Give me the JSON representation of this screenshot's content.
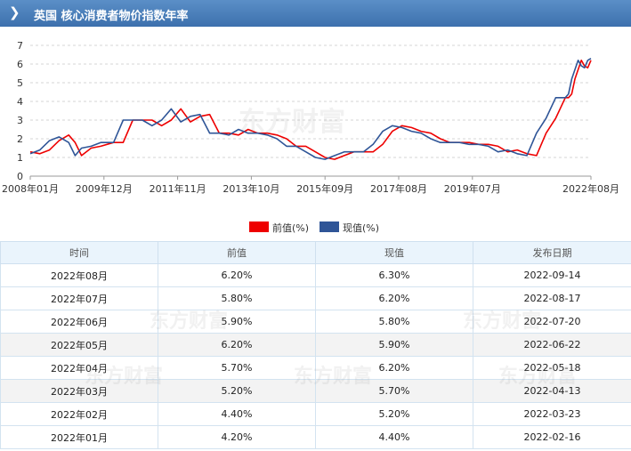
{
  "header": {
    "title": "英国 核心消费者物价指数年率"
  },
  "watermark": "东方财富",
  "legend": [
    {
      "label": "前值(%)",
      "color": "#ee0000"
    },
    {
      "label": "现值(%)",
      "color": "#2f5597"
    }
  ],
  "chart_data": {
    "type": "line",
    "ylim": [
      0,
      7
    ],
    "yticks": [
      0,
      1,
      2,
      3,
      4,
      5,
      6,
      7
    ],
    "xtick_labels": [
      "2008年01月",
      "2009年12月",
      "2011年11月",
      "2013年10月",
      "2015年09月",
      "2017年08月",
      "2019年07月",
      "2022年08月"
    ],
    "grid": "horizontal dashed",
    "legend_position": "bottom-center",
    "series": [
      {
        "name": "前值(%)",
        "color": "#ee0000",
        "points": [
          [
            "2008-01",
            1.3
          ],
          [
            "2008-04",
            1.2
          ],
          [
            "2008-07",
            1.4
          ],
          [
            "2008-10",
            1.9
          ],
          [
            "2009-01",
            2.2
          ],
          [
            "2009-03",
            1.8
          ],
          [
            "2009-05",
            1.1
          ],
          [
            "2009-08",
            1.5
          ],
          [
            "2009-11",
            1.6
          ],
          [
            "2010-03",
            1.8
          ],
          [
            "2010-06",
            1.8
          ],
          [
            "2010-09",
            3.0
          ],
          [
            "2010-12",
            3.0
          ],
          [
            "2011-03",
            3.0
          ],
          [
            "2011-06",
            2.7
          ],
          [
            "2011-09",
            3.0
          ],
          [
            "2011-12",
            3.6
          ],
          [
            "2012-03",
            2.9
          ],
          [
            "2012-06",
            3.2
          ],
          [
            "2012-09",
            3.3
          ],
          [
            "2012-12",
            2.3
          ],
          [
            "2013-03",
            2.3
          ],
          [
            "2013-06",
            2.2
          ],
          [
            "2013-09",
            2.5
          ],
          [
            "2013-12",
            2.3
          ],
          [
            "2014-03",
            2.3
          ],
          [
            "2014-06",
            2.2
          ],
          [
            "2014-09",
            2.0
          ],
          [
            "2014-12",
            1.6
          ],
          [
            "2015-03",
            1.6
          ],
          [
            "2015-06",
            1.3
          ],
          [
            "2015-09",
            1.0
          ],
          [
            "2015-12",
            0.9
          ],
          [
            "2016-03",
            1.1
          ],
          [
            "2016-06",
            1.3
          ],
          [
            "2016-09",
            1.3
          ],
          [
            "2016-12",
            1.3
          ],
          [
            "2017-03",
            1.7
          ],
          [
            "2017-06",
            2.4
          ],
          [
            "2017-09",
            2.7
          ],
          [
            "2017-12",
            2.6
          ],
          [
            "2018-03",
            2.4
          ],
          [
            "2018-06",
            2.3
          ],
          [
            "2018-09",
            2.0
          ],
          [
            "2018-12",
            1.8
          ],
          [
            "2019-03",
            1.8
          ],
          [
            "2019-06",
            1.8
          ],
          [
            "2019-09",
            1.7
          ],
          [
            "2019-12",
            1.7
          ],
          [
            "2020-03",
            1.6
          ],
          [
            "2020-06",
            1.3
          ],
          [
            "2020-09",
            1.4
          ],
          [
            "2020-12",
            1.2
          ],
          [
            "2021-03",
            1.1
          ],
          [
            "2021-06",
            2.3
          ],
          [
            "2021-09",
            3.1
          ],
          [
            "2021-12",
            4.2
          ],
          [
            "2022-01",
            4.2
          ],
          [
            "2022-02",
            4.4
          ],
          [
            "2022-03",
            5.2
          ],
          [
            "2022-04",
            5.7
          ],
          [
            "2022-05",
            6.2
          ],
          [
            "2022-06",
            5.9
          ],
          [
            "2022-07",
            5.8
          ],
          [
            "2022-08",
            6.2
          ]
        ]
      },
      {
        "name": "现值(%)",
        "color": "#2f5597",
        "points": [
          [
            "2008-01",
            1.2
          ],
          [
            "2008-04",
            1.4
          ],
          [
            "2008-07",
            1.9
          ],
          [
            "2008-10",
            2.1
          ],
          [
            "2009-01",
            1.8
          ],
          [
            "2009-03",
            1.1
          ],
          [
            "2009-05",
            1.5
          ],
          [
            "2009-08",
            1.6
          ],
          [
            "2009-11",
            1.8
          ],
          [
            "2010-03",
            1.8
          ],
          [
            "2010-06",
            3.0
          ],
          [
            "2010-09",
            3.0
          ],
          [
            "2010-12",
            3.0
          ],
          [
            "2011-03",
            2.7
          ],
          [
            "2011-06",
            3.0
          ],
          [
            "2011-09",
            3.6
          ],
          [
            "2011-12",
            2.9
          ],
          [
            "2012-03",
            3.2
          ],
          [
            "2012-06",
            3.3
          ],
          [
            "2012-09",
            2.3
          ],
          [
            "2012-12",
            2.3
          ],
          [
            "2013-03",
            2.2
          ],
          [
            "2013-06",
            2.5
          ],
          [
            "2013-09",
            2.3
          ],
          [
            "2013-12",
            2.3
          ],
          [
            "2014-03",
            2.2
          ],
          [
            "2014-06",
            2.0
          ],
          [
            "2014-09",
            1.6
          ],
          [
            "2014-12",
            1.6
          ],
          [
            "2015-03",
            1.3
          ],
          [
            "2015-06",
            1.0
          ],
          [
            "2015-09",
            0.9
          ],
          [
            "2015-12",
            1.1
          ],
          [
            "2016-03",
            1.3
          ],
          [
            "2016-06",
            1.3
          ],
          [
            "2016-09",
            1.3
          ],
          [
            "2016-12",
            1.7
          ],
          [
            "2017-03",
            2.4
          ],
          [
            "2017-06",
            2.7
          ],
          [
            "2017-09",
            2.6
          ],
          [
            "2017-12",
            2.4
          ],
          [
            "2018-03",
            2.3
          ],
          [
            "2018-06",
            2.0
          ],
          [
            "2018-09",
            1.8
          ],
          [
            "2018-12",
            1.8
          ],
          [
            "2019-03",
            1.8
          ],
          [
            "2019-06",
            1.7
          ],
          [
            "2019-09",
            1.7
          ],
          [
            "2019-12",
            1.6
          ],
          [
            "2020-03",
            1.3
          ],
          [
            "2020-06",
            1.4
          ],
          [
            "2020-09",
            1.2
          ],
          [
            "2020-12",
            1.1
          ],
          [
            "2021-03",
            2.3
          ],
          [
            "2021-06",
            3.1
          ],
          [
            "2021-09",
            4.2
          ],
          [
            "2021-12",
            4.2
          ],
          [
            "2022-01",
            4.4
          ],
          [
            "2022-02",
            5.2
          ],
          [
            "2022-03",
            5.7
          ],
          [
            "2022-04",
            6.2
          ],
          [
            "2022-05",
            5.9
          ],
          [
            "2022-06",
            5.8
          ],
          [
            "2022-07",
            6.2
          ],
          [
            "2022-08",
            6.3
          ]
        ]
      }
    ]
  },
  "table": {
    "headers": [
      "时间",
      "前值",
      "现值",
      "发布日期"
    ],
    "rows": [
      [
        "2022年08月",
        "6.20%",
        "6.30%",
        "2022-09-14"
      ],
      [
        "2022年07月",
        "5.80%",
        "6.20%",
        "2022-08-17"
      ],
      [
        "2022年06月",
        "5.90%",
        "5.80%",
        "2022-07-20"
      ],
      [
        "2022年05月",
        "6.20%",
        "5.90%",
        "2022-06-22"
      ],
      [
        "2022年04月",
        "5.70%",
        "6.20%",
        "2022-05-18"
      ],
      [
        "2022年03月",
        "5.20%",
        "5.70%",
        "2022-04-13"
      ],
      [
        "2022年02月",
        "4.40%",
        "5.20%",
        "2022-03-23"
      ],
      [
        "2022年01月",
        "4.20%",
        "4.40%",
        "2022-02-16"
      ]
    ]
  }
}
